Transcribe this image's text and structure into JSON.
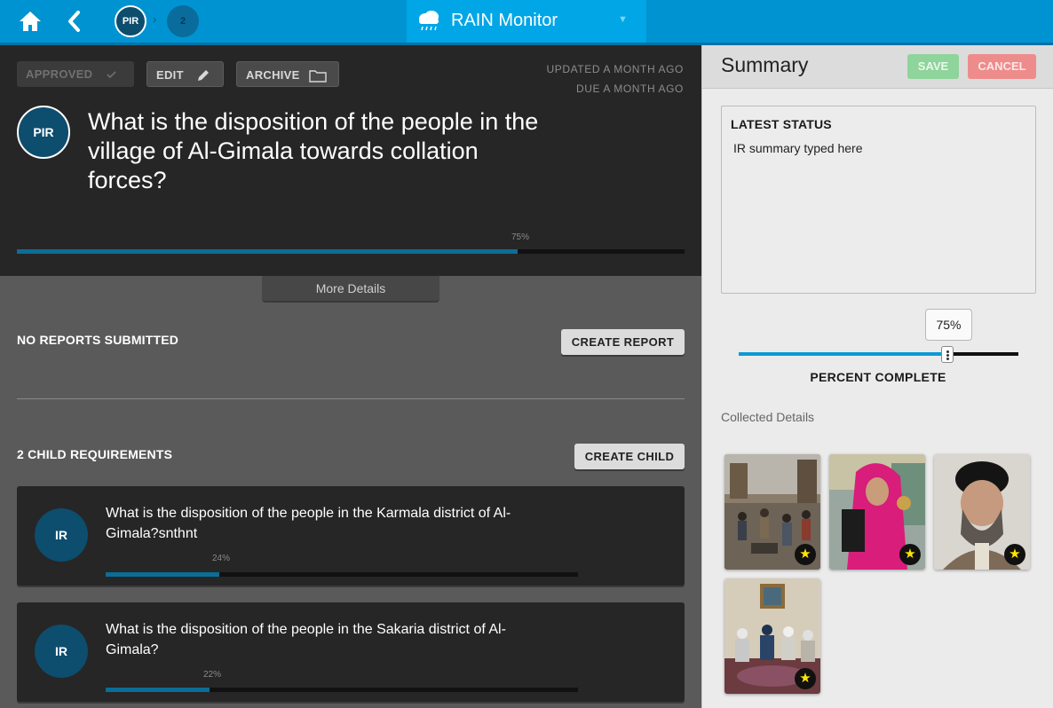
{
  "topbar": {
    "app_title": "RAIN Monitor",
    "breadcrumbs": [
      {
        "label": "PIR"
      },
      {
        "label": "2"
      }
    ],
    "icons": {
      "home": "home-icon",
      "back": "back-icon",
      "app": "rain-cloud-icon",
      "caret": "caret-down-icon",
      "separator": "chevron-right-icon"
    }
  },
  "pir": {
    "badge": "PIR",
    "title": "What is the disposition of the people in the village of Al-Gimala towards collation forces?",
    "updated": "UPDATED A MONTH AGO",
    "due": "DUE A MONTH AGO",
    "progress": 75,
    "progress_label": "75%",
    "actions": {
      "approved": "APPROVED",
      "edit": "EDIT",
      "archive": "ARCHIVE"
    },
    "more_details": "More Details"
  },
  "reports": {
    "heading": "NO REPORTS SUBMITTED",
    "create_label": "CREATE REPORT"
  },
  "children": {
    "heading": "2 CHILD REQUIREMENTS",
    "create_label": "CREATE CHILD",
    "items": [
      {
        "badge": "IR",
        "title": "What is the disposition of the people in the Karmala district of Al-Gimala?snthnt",
        "progress": 24,
        "progress_label": "24%"
      },
      {
        "badge": "IR",
        "title": "What is the disposition of the people in the Sakaria district of Al-Gimala?",
        "progress": 22,
        "progress_label": "22%"
      }
    ]
  },
  "summary": {
    "title": "Summary",
    "save_label": "SAVE",
    "cancel_label": "CANCEL",
    "status_label": "LATEST STATUS",
    "status_value": "IR summary typed here",
    "percent": 75,
    "percent_label": "75%",
    "percent_caption": "PERCENT COMPLETE",
    "collected_label": "Collected Details"
  },
  "colors": {
    "topbar": "#0093d1",
    "accent": "#0b6d98",
    "badge": "#0d4d6e",
    "save": "#8fd49a",
    "cancel": "#ee8c8c",
    "star": "#ffe600"
  }
}
